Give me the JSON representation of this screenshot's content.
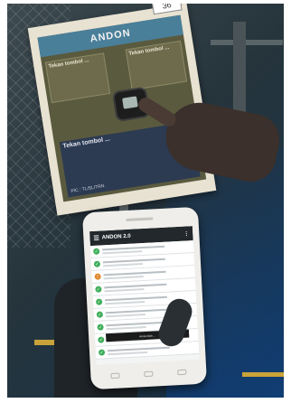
{
  "board": {
    "title": "ANDON",
    "number": "36",
    "panel_left_heading": "Tekan tombol ...",
    "panel_right_heading": "Tekan tombol ...",
    "bottom_heading": "Tekan tombol ...",
    "pic": "PIC : TL/SL/TRN"
  },
  "phone": {
    "app_title": "ANDON 2.0",
    "toast": "Anda telah ..."
  },
  "colors": {
    "board_header": "#4a7f99",
    "board_body": "#5a5a3f",
    "bottom_panel": "#2c3a52",
    "app_bar": "#22282b",
    "status_ok": "#3fae5a",
    "status_warn": "#e08a2e"
  },
  "list_rows": [
    {
      "icon": "status-ok-icon",
      "color": "#3fae5a",
      "glyph": "✓"
    },
    {
      "icon": "status-ok-icon",
      "color": "#3fae5a",
      "glyph": "✓"
    },
    {
      "icon": "status-warn-icon",
      "color": "#e08a2e",
      "glyph": "!"
    },
    {
      "icon": "status-ok-icon",
      "color": "#3fae5a",
      "glyph": "✓"
    },
    {
      "icon": "status-ok-icon",
      "color": "#3fae5a",
      "glyph": "✓"
    },
    {
      "icon": "status-ok-icon",
      "color": "#3fae5a",
      "glyph": "✓"
    },
    {
      "icon": "status-ok-icon",
      "color": "#3fae5a",
      "glyph": "✓"
    },
    {
      "icon": "status-ok-icon",
      "color": "#3fae5a",
      "glyph": "✓"
    },
    {
      "icon": "status-ok-icon",
      "color": "#3fae5a",
      "glyph": "✓"
    }
  ]
}
